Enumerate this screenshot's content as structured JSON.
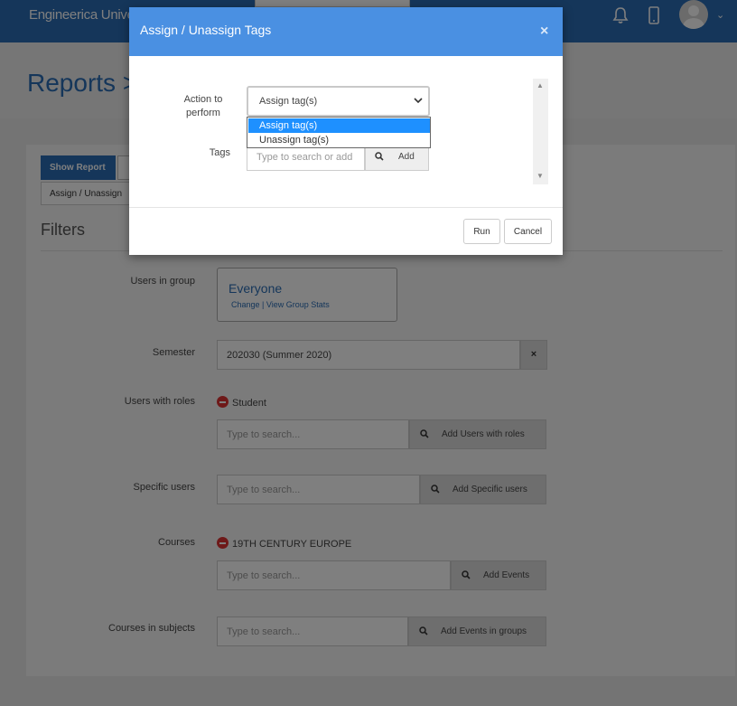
{
  "header": {
    "brand": "Engineerica Unive"
  },
  "page": {
    "title": "Reports >"
  },
  "report": {
    "show_report_label": "Show Report",
    "assign_tab_label": "Assign / Unassign",
    "filters_title": "Filters"
  },
  "filters": {
    "users_in_group": {
      "label": "Users in group",
      "group_name": "Everyone",
      "change_link": "Change",
      "separator": " | ",
      "stats_link": "View Group Stats"
    },
    "semester": {
      "label": "Semester",
      "value": "202030 (Summer 2020)",
      "clear_symbol": "×"
    },
    "users_with_roles": {
      "label": "Users with roles",
      "chip": "Student",
      "placeholder": "Type to search...",
      "button": "Add Users with roles"
    },
    "specific_users": {
      "label": "Specific users",
      "placeholder": "Type to search...",
      "button": "Add Specific users"
    },
    "courses": {
      "label": "Courses",
      "chip": "19TH CENTURY EUROPE",
      "placeholder": "Type to search...",
      "button": "Add Events"
    },
    "courses_in_subjects": {
      "label": "Courses in subjects",
      "placeholder": "Type to search...",
      "button": "Add Events in groups"
    }
  },
  "modal": {
    "title": "Assign / Unassign Tags",
    "close_symbol": "×",
    "action_label_line1": "Action to",
    "action_label_line2": "perform",
    "action_selected": "Assign tag(s)",
    "action_options": [
      "Assign tag(s)",
      "Unassign tag(s)"
    ],
    "tags_label": "Tags",
    "tags_placeholder": "Type to search or add",
    "tags_add_button": "Add",
    "run_button": "Run",
    "cancel_button": "Cancel"
  },
  "icons": {
    "bell": "bell-icon",
    "mobile": "mobile-icon",
    "avatar": "user-avatar-icon",
    "search": "search-icon",
    "remove": "minus-circle-icon",
    "dropdown": "chevron-down-icon"
  },
  "colors": {
    "brand_blue": "#2a6db5",
    "modal_header": "#4a90e2",
    "selected_option": "#1e90ff",
    "remove_badge": "#dd3333"
  }
}
